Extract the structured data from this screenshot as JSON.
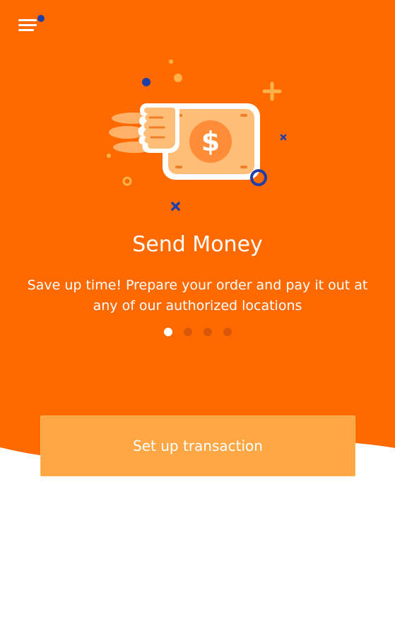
{
  "colors": {
    "hero_orange": "#ff6a00",
    "button_orange": "#ffa744",
    "accent_navy": "#1f3fa8",
    "white": "#ffffff"
  },
  "header": {
    "menu_icon": "hamburger-menu-icon",
    "notification_dot": "notification-dot"
  },
  "onboarding": {
    "illustration_icon": "money-bill-hand-icon",
    "title": "Send Money",
    "description": "Save up time! Prepare your order and pay it out at any of our authorized locations",
    "pager": {
      "total": 4,
      "active_index": 0
    }
  },
  "cta": {
    "label": "Set up transaction"
  }
}
